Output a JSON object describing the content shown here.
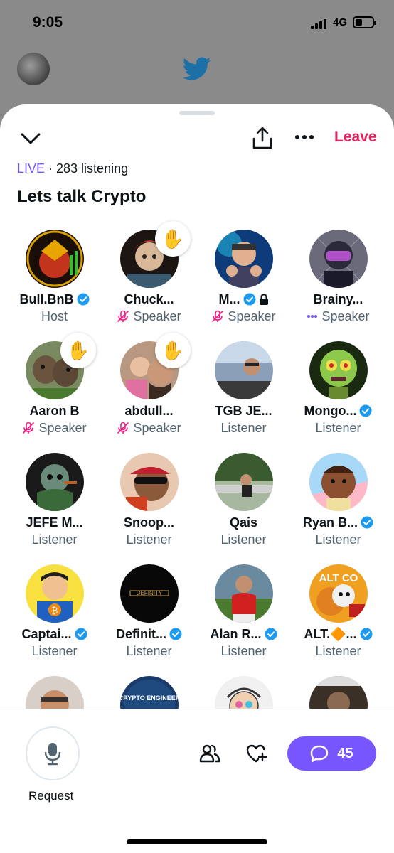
{
  "status_bar": {
    "time": "9:05",
    "network": "4G"
  },
  "header": {
    "leave_label": "Leave"
  },
  "space": {
    "live_label": "LIVE",
    "listening_text": " · 283 listening",
    "title": "Lets talk Crypto"
  },
  "participants": [
    {
      "name": "Bull.BnB",
      "role": "Host",
      "verified": true,
      "mic": "none",
      "hand": false
    },
    {
      "name": "Chuck...",
      "role": "Speaker",
      "verified": false,
      "mic": "muted",
      "hand": true
    },
    {
      "name": "M...",
      "role": "Speaker",
      "verified": true,
      "locked": true,
      "mic": "muted",
      "hand": false
    },
    {
      "name": "Brainy...",
      "role": "Speaker",
      "verified": false,
      "mic": "talking",
      "hand": false
    },
    {
      "name": "Aaron B",
      "role": "Speaker",
      "verified": false,
      "mic": "muted",
      "hand": true
    },
    {
      "name": "abdull...",
      "role": "Speaker",
      "verified": false,
      "mic": "muted",
      "hand": true
    },
    {
      "name": "TGB JE...",
      "role": "Listener",
      "verified": false,
      "mic": "none",
      "hand": false
    },
    {
      "name": "Mongo...",
      "role": "Listener",
      "verified": true,
      "mic": "none",
      "hand": false
    },
    {
      "name": "JEFE M...",
      "role": "Listener",
      "verified": false,
      "mic": "none",
      "hand": false
    },
    {
      "name": "Snoop...",
      "role": "Listener",
      "verified": false,
      "mic": "none",
      "hand": false
    },
    {
      "name": "Qais",
      "role": "Listener",
      "verified": false,
      "mic": "none",
      "hand": false
    },
    {
      "name": "Ryan B...",
      "role": "Listener",
      "verified": true,
      "mic": "none",
      "hand": false
    },
    {
      "name": "Captai...",
      "role": "Listener",
      "verified": true,
      "mic": "none",
      "hand": false
    },
    {
      "name": "Definit...",
      "role": "Listener",
      "verified": true,
      "mic": "none",
      "hand": false
    },
    {
      "name": "Alan R...",
      "role": "Listener",
      "verified": true,
      "mic": "none",
      "hand": false
    },
    {
      "name": "ALT.🔶...",
      "role": "Listener",
      "verified": true,
      "mic": "none",
      "hand": false
    },
    {
      "name": "",
      "role": "",
      "verified": false,
      "mic": "none",
      "hand": false
    },
    {
      "name": "",
      "role": "",
      "verified": false,
      "mic": "none",
      "hand": false
    },
    {
      "name": "",
      "role": "",
      "verified": false,
      "mic": "none",
      "hand": false
    },
    {
      "name": "",
      "role": "",
      "verified": false,
      "mic": "none",
      "hand": false
    }
  ],
  "hand_emoji": "✋",
  "avatar_text": {
    "definit": "DEFINITY",
    "alt": "ALT CO",
    "crypto": "CRYPTO ENGINEER"
  },
  "bottom": {
    "request_label": "Request",
    "chat_count": "45"
  },
  "colors": {
    "accent": "#7856ff",
    "leave": "#e0245e",
    "verified": "#1d9bf0",
    "muted": "#f91880",
    "secondary_text": "#536471"
  }
}
